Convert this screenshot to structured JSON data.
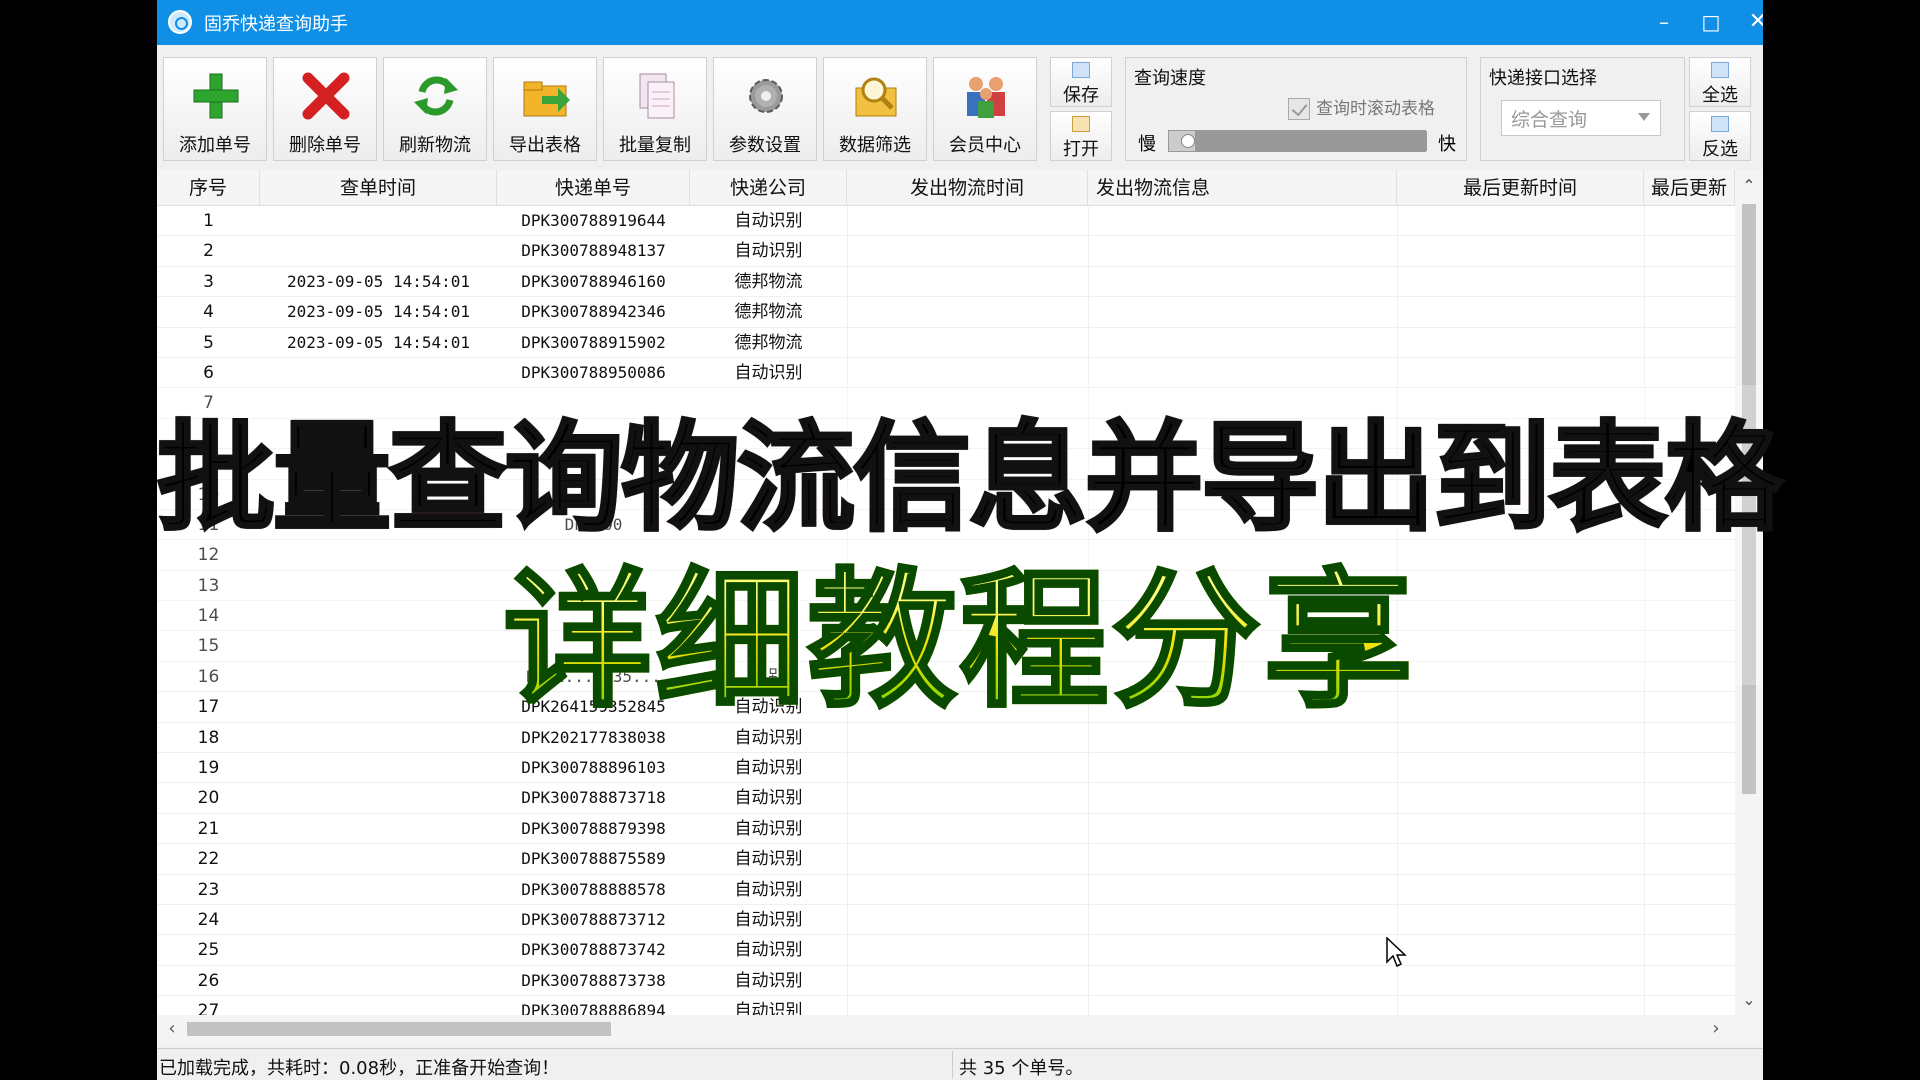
{
  "window": {
    "title": "固乔快递查询助手"
  },
  "toolbar": {
    "buttons": [
      {
        "label": "添加单号",
        "icon": "add-icon"
      },
      {
        "label": "删除单号",
        "icon": "delete-icon"
      },
      {
        "label": "刷新物流",
        "icon": "refresh-icon"
      },
      {
        "label": "导出表格",
        "icon": "export-folder-icon"
      },
      {
        "label": "批量复制",
        "icon": "copy-icon"
      },
      {
        "label": "参数设置",
        "icon": "gear-icon"
      },
      {
        "label": "数据筛选",
        "icon": "filter-search-icon"
      },
      {
        "label": "会员中心",
        "icon": "members-icon"
      }
    ],
    "save_label": "保存",
    "open_label": "打开",
    "speed": {
      "title": "查询速度",
      "scroll_checkbox": "查询时滚动表格",
      "scroll_checked": true,
      "slow": "慢",
      "fast": "快",
      "level": 0.1
    },
    "api": {
      "title": "快递接口选择",
      "selected": "综合查询"
    },
    "select_all_label": "全选",
    "invert_label": "反选"
  },
  "table": {
    "columns": [
      "序号",
      "查单时间",
      "快递单号",
      "快递公司",
      "发出物流时间",
      "发出物流信息",
      "最后更新时间",
      "最后更新"
    ],
    "rows": [
      [
        "1",
        "",
        "DPK300788919644",
        "自动识别"
      ],
      [
        "2",
        "",
        "DPK300788948137",
        "自动识别"
      ],
      [
        "3",
        "2023-09-05 14:54:01",
        "DPK300788946160",
        "德邦物流"
      ],
      [
        "4",
        "2023-09-05 14:54:01",
        "DPK300788942346",
        "德邦物流"
      ],
      [
        "5",
        "2023-09-05 14:54:01",
        "DPK300788915902",
        "德邦物流"
      ],
      [
        "6",
        "",
        "DPK300788950086",
        "自动识别"
      ],
      [
        "7",
        "",
        "",
        ""
      ],
      [
        "8",
        "",
        "",
        ""
      ],
      [
        "9",
        "",
        "",
        ""
      ],
      [
        "10",
        "",
        "",
        ""
      ],
      [
        "11",
        "",
        "DPK300",
        ""
      ],
      [
        "12",
        "",
        "",
        ""
      ],
      [
        "13",
        "",
        "",
        ""
      ],
      [
        "14",
        "",
        "",
        ""
      ],
      [
        "15",
        "",
        "",
        ""
      ],
      [
        "16",
        "",
        "DPK2...5935...",
        "...别"
      ],
      [
        "17",
        "",
        "DPK264159352845",
        "自动识别"
      ],
      [
        "18",
        "",
        "DPK202177838038",
        "自动识别"
      ],
      [
        "19",
        "",
        "DPK300788896103",
        "自动识别"
      ],
      [
        "20",
        "",
        "DPK300788873718",
        "自动识别"
      ],
      [
        "21",
        "",
        "DPK300788879398",
        "自动识别"
      ],
      [
        "22",
        "",
        "DPK300788875589",
        "自动识别"
      ],
      [
        "23",
        "",
        "DPK300788888578",
        "自动识别"
      ],
      [
        "24",
        "",
        "DPK300788873712",
        "自动识别"
      ],
      [
        "25",
        "",
        "DPK300788873742",
        "自动识别"
      ],
      [
        "26",
        "",
        "DPK300788873738",
        "自动识别"
      ],
      [
        "27",
        "",
        "DPK300788886894",
        "自动识别"
      ]
    ]
  },
  "status": {
    "left": "已加载完成，共耗时：0.08秒，正准备开始查询！",
    "right": "共 35 个单号。"
  },
  "overlay": {
    "headline": "批量查询物流信息并导出到表格",
    "subline": "详细教程分享"
  },
  "colors": {
    "titlebar": "#0f8fe6",
    "headline_red": "#8a2020",
    "subline_yellow": "#ffff40",
    "subline_green": "#50d000"
  }
}
